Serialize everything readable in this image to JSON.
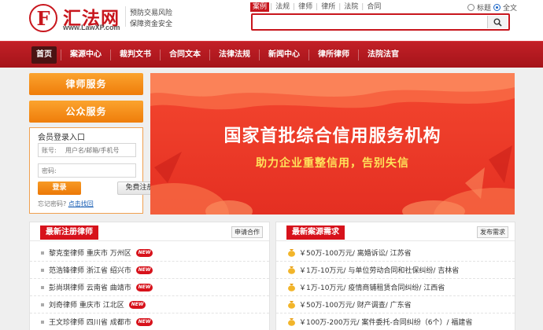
{
  "header": {
    "logo_letter": "F",
    "site_name": "汇法网",
    "site_url": "www.LawXP.com",
    "slogan_line1": "预防交易风险",
    "slogan_line2": "保障资金安全"
  },
  "search": {
    "tabs": [
      {
        "label": "案例",
        "active": true
      },
      {
        "label": "法规",
        "active": false
      },
      {
        "label": "律师",
        "active": false
      },
      {
        "label": "律所",
        "active": false
      },
      {
        "label": "法院",
        "active": false
      },
      {
        "label": "合同",
        "active": false
      }
    ],
    "radio_title": "标题",
    "radio_fulltext": "全文",
    "value": "",
    "placeholder": ""
  },
  "nav": {
    "items": [
      "首页",
      "案源中心",
      "裁判文书",
      "合同文本",
      "法律法规",
      "新闻中心",
      "律所律师",
      "法院法官"
    ]
  },
  "sidebar": {
    "lawyer_service": "律师服务",
    "public_service": "公众服务",
    "login": {
      "title": "会员登录入口",
      "account_label": "账号:",
      "account_placeholder": "用户名/邮箱/手机号",
      "password_label": "密码:",
      "login_button": "登录",
      "register_button": "免费注册",
      "forgot_text": "忘记密码?",
      "forgot_link": "点击找回"
    }
  },
  "banner": {
    "title": "国家首批综合信用服务机构",
    "subtitle": "助力企业重整信用，告别失信"
  },
  "lawyers_panel": {
    "title": "最新注册律师",
    "more": "申请合作",
    "new_badge": "NEW",
    "rows": [
      "黎克奎律师  重庆市 万州区",
      "范浩锋律师  浙江省 绍兴市",
      "彭尚琪律师  云南省 曲靖市",
      "刘奇律师  重庆市 江北区",
      "王文珍律师  四川省 成都市"
    ]
  },
  "cases_panel": {
    "title": "最新案源需求",
    "more": "发布需求",
    "rows": [
      "￥50万-100万元/ 离婚诉讼/ 江苏省",
      "￥1万-10万元/ 与单位劳动合同和社保纠纷/ 吉林省",
      "￥1万-10万元/ 疫情商铺租赁合同纠纷/ 江西省",
      "￥50万-100万元/ 财产调查/ 广东省",
      "￥100万-200万元/ 案件委托-合同纠纷（6个）/ 福建省"
    ]
  },
  "colors": {
    "brand_red": "#c8161d",
    "orange": "#f08a14",
    "banner_red": "#ee3b29",
    "subtitle_yellow": "#ffe35a"
  }
}
